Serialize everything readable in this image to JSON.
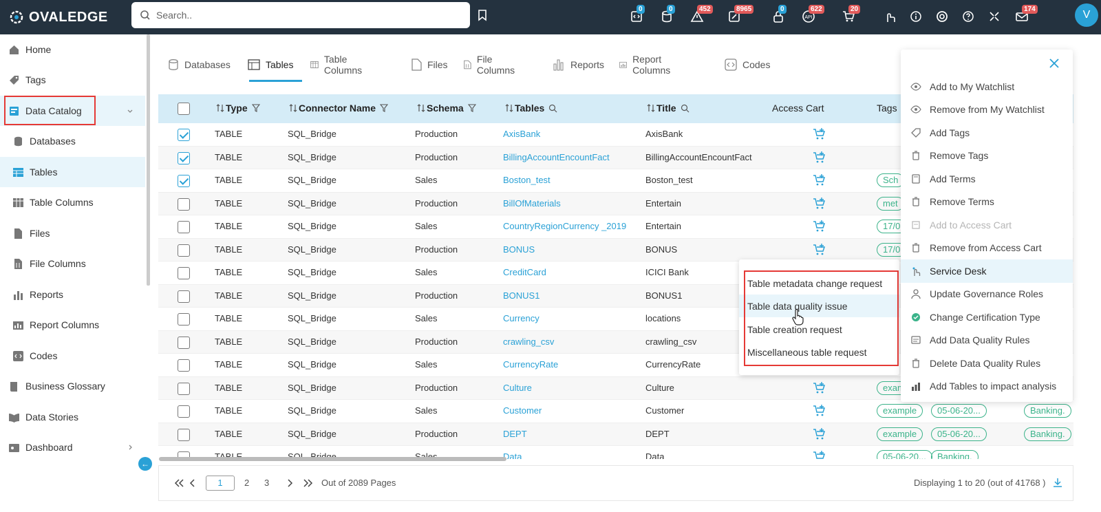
{
  "header": {
    "logo_text": "OVALEDGE",
    "search_placeholder": "Search..",
    "badges": [
      "0",
      "0",
      "452",
      "8965",
      "0",
      "622",
      "20",
      "174"
    ],
    "avatar_letter": "V"
  },
  "sidebar": {
    "items": [
      {
        "label": "Home",
        "icon": "home-icon"
      },
      {
        "label": "Tags",
        "icon": "tag-icon"
      },
      {
        "label": "Data Catalog",
        "icon": "catalog-icon"
      },
      {
        "label": "Databases",
        "icon": "database-icon"
      },
      {
        "label": "Tables",
        "icon": "table-icon"
      },
      {
        "label": "Table Columns",
        "icon": "table-columns-icon"
      },
      {
        "label": "Files",
        "icon": "file-icon"
      },
      {
        "label": "File Columns",
        "icon": "file-columns-icon"
      },
      {
        "label": "Reports",
        "icon": "report-icon"
      },
      {
        "label": "Report Columns",
        "icon": "report-columns-icon"
      },
      {
        "label": "Codes",
        "icon": "code-icon"
      },
      {
        "label": "Business Glossary",
        "icon": "glossary-icon"
      },
      {
        "label": "Data Stories",
        "icon": "stories-icon"
      },
      {
        "label": "Dashboard",
        "icon": "dashboard-icon"
      }
    ]
  },
  "tabs": [
    "Databases",
    "Tables",
    "Table Columns",
    "Files",
    "File Columns",
    "Reports",
    "Report Columns",
    "Codes"
  ],
  "table": {
    "headers": {
      "type": "Type",
      "connector": "Connector Name",
      "schema": "Schema",
      "tables": "Tables",
      "title": "Title",
      "access_cart": "Access Cart",
      "tags": "Tags"
    },
    "rows": [
      {
        "checked": true,
        "type": "TABLE",
        "connector": "SQL_Bridge",
        "schema": "Production",
        "table": "AxisBank",
        "title": "AxisBank",
        "tags": []
      },
      {
        "checked": true,
        "type": "TABLE",
        "connector": "SQL_Bridge",
        "schema": "Production",
        "table": "BillingAccountEncountFact",
        "title": "BillingAccountEncountFact",
        "tags": []
      },
      {
        "checked": true,
        "type": "TABLE",
        "connector": "SQL_Bridge",
        "schema": "Sales",
        "table": "Boston_test",
        "title": "Boston_test",
        "tags": [
          "Sch"
        ]
      },
      {
        "checked": false,
        "type": "TABLE",
        "connector": "SQL_Bridge",
        "schema": "Production",
        "table": "BillOfMaterials",
        "title": "Entertain",
        "tags": [
          "met"
        ]
      },
      {
        "checked": false,
        "type": "TABLE",
        "connector": "SQL_Bridge",
        "schema": "Sales",
        "table": "CountryRegionCurrency _2019",
        "title": "Entertain",
        "tags": [
          "17/0"
        ]
      },
      {
        "checked": false,
        "type": "TABLE",
        "connector": "SQL_Bridge",
        "schema": "Production",
        "table": "BONUS",
        "title": "BONUS",
        "tags": [
          "17/0"
        ]
      },
      {
        "checked": false,
        "type": "TABLE",
        "connector": "SQL_Bridge",
        "schema": "Sales",
        "table": "CreditCard",
        "title": "ICICI Bank",
        "tags": []
      },
      {
        "checked": false,
        "type": "TABLE",
        "connector": "SQL_Bridge",
        "schema": "Production",
        "table": "BONUS1",
        "title": "BONUS1",
        "tags": []
      },
      {
        "checked": false,
        "type": "TABLE",
        "connector": "SQL_Bridge",
        "schema": "Sales",
        "table": "Currency",
        "title": "locations",
        "tags": []
      },
      {
        "checked": false,
        "type": "TABLE",
        "connector": "SQL_Bridge",
        "schema": "Production",
        "table": "crawling_csv",
        "title": "crawling_csv",
        "tags": []
      },
      {
        "checked": false,
        "type": "TABLE",
        "connector": "SQL_Bridge",
        "schema": "Sales",
        "table": "CurrencyRate",
        "title": "CurrencyRate",
        "tags": []
      },
      {
        "checked": false,
        "type": "TABLE",
        "connector": "SQL_Bridge",
        "schema": "Production",
        "table": "Culture",
        "title": "Culture",
        "tags": [
          "exam"
        ]
      },
      {
        "checked": false,
        "type": "TABLE",
        "connector": "SQL_Bridge",
        "schema": "Sales",
        "table": "Customer",
        "title": "Customer",
        "tags": [
          "example",
          "05-06-20...",
          "Banking."
        ]
      },
      {
        "checked": false,
        "type": "TABLE",
        "connector": "SQL_Bridge",
        "schema": "Production",
        "table": "DEPT",
        "title": "DEPT",
        "tags": [
          "example",
          "05-06-20...",
          "Banking."
        ]
      },
      {
        "checked": false,
        "type": "TABLE",
        "connector": "SQL_Bridge",
        "schema": "Sales",
        "table": "Data",
        "title": "Data",
        "tags": [
          "05-06-20...",
          "Banking."
        ]
      }
    ]
  },
  "pagination": {
    "current": "1",
    "pages": [
      "2",
      "3"
    ],
    "out_of": "Out of 2089 Pages",
    "displaying": "Displaying 1 to 20 (out of 41768 )"
  },
  "service_desk_menu": [
    "Table metadata change request",
    "Table data quality issue",
    "Table creation request",
    "Miscellaneous table request"
  ],
  "action_panel": [
    {
      "label": "Add to My Watchlist",
      "icon": "eye-icon"
    },
    {
      "label": "Remove from My Watchlist",
      "icon": "eye-off-icon"
    },
    {
      "label": "Add Tags",
      "icon": "tag-icon"
    },
    {
      "label": "Remove Tags",
      "icon": "trash-icon"
    },
    {
      "label": "Add Terms",
      "icon": "terms-icon"
    },
    {
      "label": "Remove Terms",
      "icon": "trash-icon"
    },
    {
      "label": "Add to Access Cart",
      "icon": "cart-icon"
    },
    {
      "label": "Remove from Access Cart",
      "icon": "trash-icon"
    },
    {
      "label": "Service Desk",
      "icon": "service-desk-icon"
    },
    {
      "label": "Update Governance Roles",
      "icon": "roles-icon"
    },
    {
      "label": "Change Certification Type",
      "icon": "certification-icon"
    },
    {
      "label": "Add Data Quality Rules",
      "icon": "dq-rules-icon"
    },
    {
      "label": "Delete Data Quality Rules",
      "icon": "trash-icon"
    },
    {
      "label": "Add Tables to impact analysis",
      "icon": "impact-icon"
    }
  ]
}
